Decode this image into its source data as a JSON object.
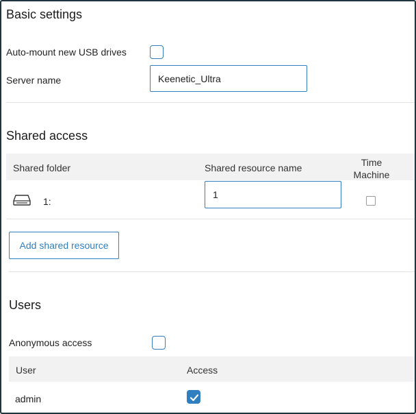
{
  "basic": {
    "title": "Basic settings",
    "automount_label": "Auto-mount new USB drives",
    "automount_checked": false,
    "server_name_label": "Server name",
    "server_name_value": "Keenetic_Ultra"
  },
  "shared": {
    "title": "Shared access",
    "columns": {
      "folder": "Shared folder",
      "resource_name": "Shared resource name",
      "time_machine_line1": "Time",
      "time_machine_line2": "Machine"
    },
    "rows": [
      {
        "icon": "drive-icon",
        "folder": "1:",
        "resource_name": "1",
        "time_machine": false
      }
    ],
    "add_button": "Add shared resource"
  },
  "users": {
    "title": "Users",
    "anonymous_label": "Anonymous access",
    "anonymous_checked": false,
    "columns": {
      "user": "User",
      "access": "Access"
    },
    "rows": [
      {
        "user": "admin",
        "access": true
      }
    ]
  },
  "colors": {
    "accent": "#2f7fc1",
    "header_bg": "#f2f2f2",
    "divider": "#e3e3e3",
    "frame": "#1f3540"
  }
}
